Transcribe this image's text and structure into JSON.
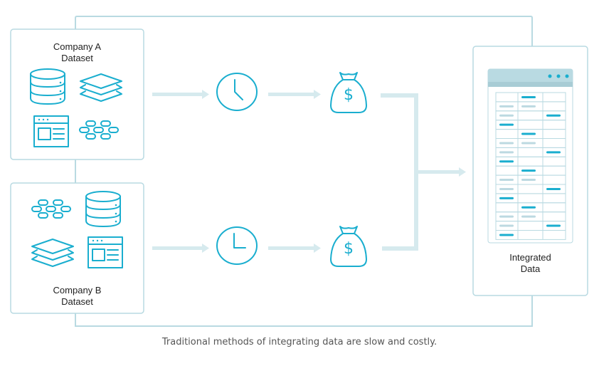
{
  "colors": {
    "accent": "#1aaecf",
    "frame": "#b9dae2",
    "arrow": "#d6eaee",
    "table_header": "#b9dae2",
    "table_header_band": "#a8ccd5",
    "table_line": "#b9dae2",
    "placeholder_bar": "#bcd9e1"
  },
  "company_a": {
    "title_line1": "Company A",
    "title_line2": "Dataset",
    "icons": [
      "database-icon",
      "layers-icon",
      "browser-window-icon",
      "network-nodes-icon"
    ]
  },
  "company_b": {
    "title_line1": "Company B",
    "title_line2": "Dataset",
    "icons": [
      "network-nodes-icon",
      "database-icon",
      "layers-icon",
      "browser-window-icon"
    ]
  },
  "flows": [
    {
      "from": "Company A Dataset",
      "steps": [
        "clock-icon",
        "money-bag-icon"
      ],
      "clock_time": "4:00"
    },
    {
      "from": "Company B Dataset",
      "steps": [
        "clock-icon",
        "money-bag-icon"
      ],
      "clock_time": "3:00"
    }
  ],
  "integrated": {
    "title_line1": "Integrated",
    "title_line2": "Data",
    "table": {
      "columns": 3,
      "rows": [
        [
          "",
          "accent",
          ""
        ],
        [
          "muted",
          "muted",
          ""
        ],
        [
          "muted",
          "",
          "accent"
        ],
        [
          "accent",
          "",
          ""
        ],
        [
          "",
          "accent",
          ""
        ],
        [
          "muted",
          "muted",
          ""
        ],
        [
          "muted",
          "",
          "accent"
        ],
        [
          "accent",
          "",
          ""
        ],
        [
          "",
          "accent",
          ""
        ],
        [
          "muted",
          "muted",
          ""
        ],
        [
          "muted",
          "",
          "accent"
        ],
        [
          "accent",
          "",
          ""
        ],
        [
          "",
          "accent",
          ""
        ],
        [
          "muted",
          "muted",
          ""
        ],
        [
          "muted",
          "",
          "accent"
        ],
        [
          "accent",
          "",
          ""
        ]
      ]
    }
  },
  "caption": "Traditional methods of integrating data are slow and costly."
}
